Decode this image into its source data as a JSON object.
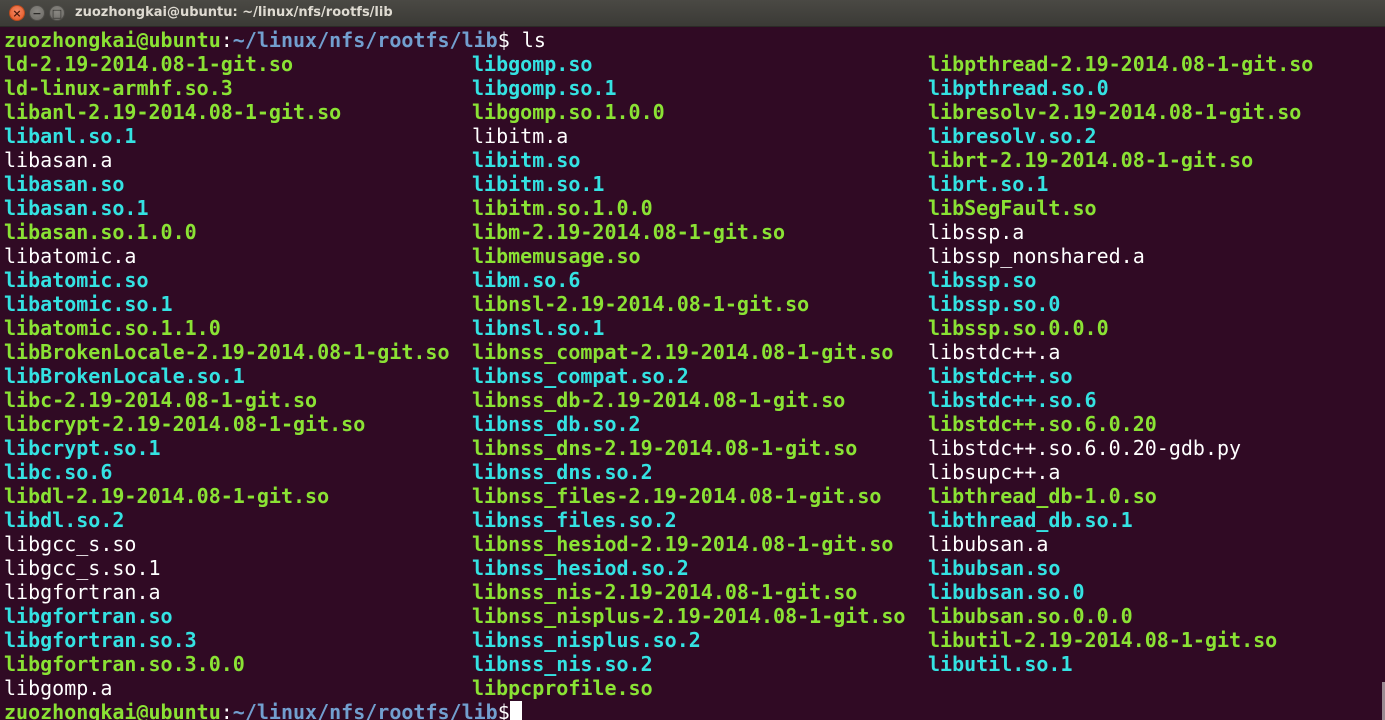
{
  "window": {
    "title": "zuozhongkai@ubuntu: ~/linux/nfs/rootfs/lib",
    "close_glyph": "×",
    "minimize_glyph": "−",
    "maximize_glyph": "□"
  },
  "prompt": {
    "user_host": "zuozhongkai@ubuntu",
    "separator": ":",
    "path": "~/linux/nfs/rootfs/lib",
    "dollar": "$",
    "command": " ls"
  },
  "colors": {
    "background": "#300a24",
    "executable": "#8ae234",
    "symlink": "#34e2e2",
    "regular": "#ffffff",
    "path": "#729fcf"
  },
  "listing": {
    "columns": [
      [
        {
          "name": "ld-2.19-2014.08-1-git.so",
          "type": "exe"
        },
        {
          "name": "ld-linux-armhf.so.3",
          "type": "exe"
        },
        {
          "name": "libanl-2.19-2014.08-1-git.so",
          "type": "exe"
        },
        {
          "name": "libanl.so.1",
          "type": "link"
        },
        {
          "name": "libasan.a",
          "type": "reg"
        },
        {
          "name": "libasan.so",
          "type": "link"
        },
        {
          "name": "libasan.so.1",
          "type": "link"
        },
        {
          "name": "libasan.so.1.0.0",
          "type": "exe"
        },
        {
          "name": "libatomic.a",
          "type": "reg"
        },
        {
          "name": "libatomic.so",
          "type": "link"
        },
        {
          "name": "libatomic.so.1",
          "type": "link"
        },
        {
          "name": "libatomic.so.1.1.0",
          "type": "exe"
        },
        {
          "name": "libBrokenLocale-2.19-2014.08-1-git.so",
          "type": "exe"
        },
        {
          "name": "libBrokenLocale.so.1",
          "type": "link"
        },
        {
          "name": "libc-2.19-2014.08-1-git.so",
          "type": "exe"
        },
        {
          "name": "libcrypt-2.19-2014.08-1-git.so",
          "type": "exe"
        },
        {
          "name": "libcrypt.so.1",
          "type": "link"
        },
        {
          "name": "libc.so.6",
          "type": "link"
        },
        {
          "name": "libdl-2.19-2014.08-1-git.so",
          "type": "exe"
        },
        {
          "name": "libdl.so.2",
          "type": "link"
        },
        {
          "name": "libgcc_s.so",
          "type": "reg"
        },
        {
          "name": "libgcc_s.so.1",
          "type": "reg"
        },
        {
          "name": "libgfortran.a",
          "type": "reg"
        },
        {
          "name": "libgfortran.so",
          "type": "link"
        },
        {
          "name": "libgfortran.so.3",
          "type": "link"
        },
        {
          "name": "libgfortran.so.3.0.0",
          "type": "exe"
        },
        {
          "name": "libgomp.a",
          "type": "reg"
        }
      ],
      [
        {
          "name": "libgomp.so",
          "type": "link"
        },
        {
          "name": "libgomp.so.1",
          "type": "link"
        },
        {
          "name": "libgomp.so.1.0.0",
          "type": "exe"
        },
        {
          "name": "libitm.a",
          "type": "reg"
        },
        {
          "name": "libitm.so",
          "type": "link"
        },
        {
          "name": "libitm.so.1",
          "type": "link"
        },
        {
          "name": "libitm.so.1.0.0",
          "type": "exe"
        },
        {
          "name": "libm-2.19-2014.08-1-git.so",
          "type": "exe"
        },
        {
          "name": "libmemusage.so",
          "type": "exe"
        },
        {
          "name": "libm.so.6",
          "type": "link"
        },
        {
          "name": "libnsl-2.19-2014.08-1-git.so",
          "type": "exe"
        },
        {
          "name": "libnsl.so.1",
          "type": "link"
        },
        {
          "name": "libnss_compat-2.19-2014.08-1-git.so",
          "type": "exe"
        },
        {
          "name": "libnss_compat.so.2",
          "type": "link"
        },
        {
          "name": "libnss_db-2.19-2014.08-1-git.so",
          "type": "exe"
        },
        {
          "name": "libnss_db.so.2",
          "type": "link"
        },
        {
          "name": "libnss_dns-2.19-2014.08-1-git.so",
          "type": "exe"
        },
        {
          "name": "libnss_dns.so.2",
          "type": "link"
        },
        {
          "name": "libnss_files-2.19-2014.08-1-git.so",
          "type": "exe"
        },
        {
          "name": "libnss_files.so.2",
          "type": "link"
        },
        {
          "name": "libnss_hesiod-2.19-2014.08-1-git.so",
          "type": "exe"
        },
        {
          "name": "libnss_hesiod.so.2",
          "type": "link"
        },
        {
          "name": "libnss_nis-2.19-2014.08-1-git.so",
          "type": "exe"
        },
        {
          "name": "libnss_nisplus-2.19-2014.08-1-git.so",
          "type": "exe"
        },
        {
          "name": "libnss_nisplus.so.2",
          "type": "link"
        },
        {
          "name": "libnss_nis.so.2",
          "type": "link"
        },
        {
          "name": "libpcprofile.so",
          "type": "exe"
        }
      ],
      [
        {
          "name": "libpthread-2.19-2014.08-1-git.so",
          "type": "exe"
        },
        {
          "name": "libpthread.so.0",
          "type": "link"
        },
        {
          "name": "libresolv-2.19-2014.08-1-git.so",
          "type": "exe"
        },
        {
          "name": "libresolv.so.2",
          "type": "link"
        },
        {
          "name": "librt-2.19-2014.08-1-git.so",
          "type": "exe"
        },
        {
          "name": "librt.so.1",
          "type": "link"
        },
        {
          "name": "libSegFault.so",
          "type": "exe"
        },
        {
          "name": "libssp.a",
          "type": "reg"
        },
        {
          "name": "libssp_nonshared.a",
          "type": "reg"
        },
        {
          "name": "libssp.so",
          "type": "link"
        },
        {
          "name": "libssp.so.0",
          "type": "link"
        },
        {
          "name": "libssp.so.0.0.0",
          "type": "exe"
        },
        {
          "name": "libstdc++.a",
          "type": "reg"
        },
        {
          "name": "libstdc++.so",
          "type": "link"
        },
        {
          "name": "libstdc++.so.6",
          "type": "link"
        },
        {
          "name": "libstdc++.so.6.0.20",
          "type": "exe"
        },
        {
          "name": "libstdc++.so.6.0.20-gdb.py",
          "type": "reg"
        },
        {
          "name": "libsupc++.a",
          "type": "reg"
        },
        {
          "name": "libthread_db-1.0.so",
          "type": "exe"
        },
        {
          "name": "libthread_db.so.1",
          "type": "link"
        },
        {
          "name": "libubsan.a",
          "type": "reg"
        },
        {
          "name": "libubsan.so",
          "type": "link"
        },
        {
          "name": "libubsan.so.0",
          "type": "link"
        },
        {
          "name": "libubsan.so.0.0.0",
          "type": "exe"
        },
        {
          "name": "libutil-2.19-2014.08-1-git.so",
          "type": "exe"
        },
        {
          "name": "libutil.so.1",
          "type": "link"
        }
      ]
    ]
  }
}
